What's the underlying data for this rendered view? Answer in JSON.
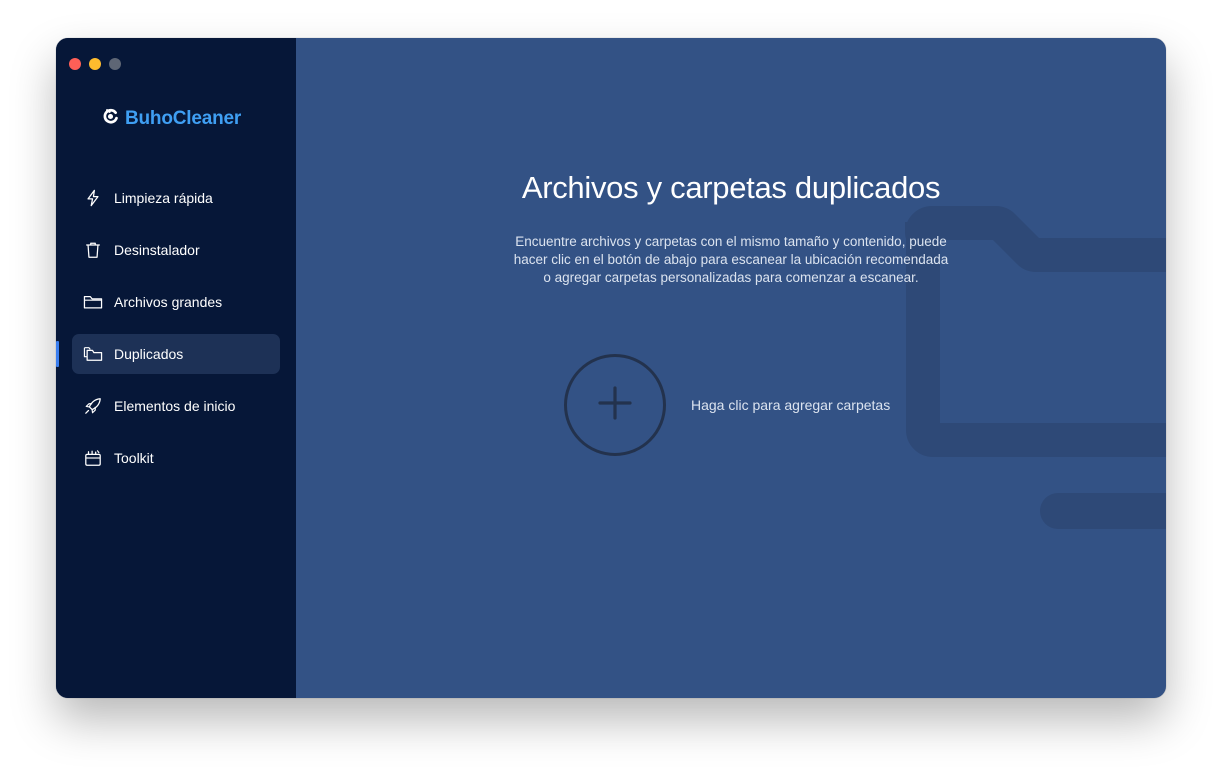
{
  "window": {
    "traffic_lights": {
      "close_color": "#fe5f57",
      "minimize_color": "#febc2e",
      "zoom_color": "#5e6675"
    }
  },
  "app": {
    "name": "BuhoCleaner",
    "logo_icon": "buho-logo-icon",
    "brand_color": "#3f9ff3"
  },
  "sidebar": {
    "items": [
      {
        "label": "Limpieza rápida",
        "icon": "lightning-icon",
        "active": false
      },
      {
        "label": "Desinstalador",
        "icon": "trash-icon",
        "active": false
      },
      {
        "label": "Archivos grandes",
        "icon": "folder-icon",
        "active": false
      },
      {
        "label": "Duplicados",
        "icon": "duplicate-folders-icon",
        "active": true
      },
      {
        "label": "Elementos de inicio",
        "icon": "rocket-icon",
        "active": false
      },
      {
        "label": "Toolkit",
        "icon": "toolkit-icon",
        "active": false
      }
    ]
  },
  "main": {
    "title": "Archivos y carpetas duplicados",
    "description": "Encuentre archivos y carpetas con el mismo tamaño y contenido, puede hacer clic en el botón de abajo para escanear la ubicación recomendada o agregar carpetas personalizadas para comenzar a escanear.",
    "add_button_icon": "plus-icon",
    "add_label": "Haga clic para agregar carpetas",
    "background_icon": "folder-watermark-icon"
  },
  "colors": {
    "sidebar_bg": "#061738",
    "main_bg": "#335285",
    "active_item_bg": "#1d3156",
    "active_indicator": "#3a7ef0"
  }
}
